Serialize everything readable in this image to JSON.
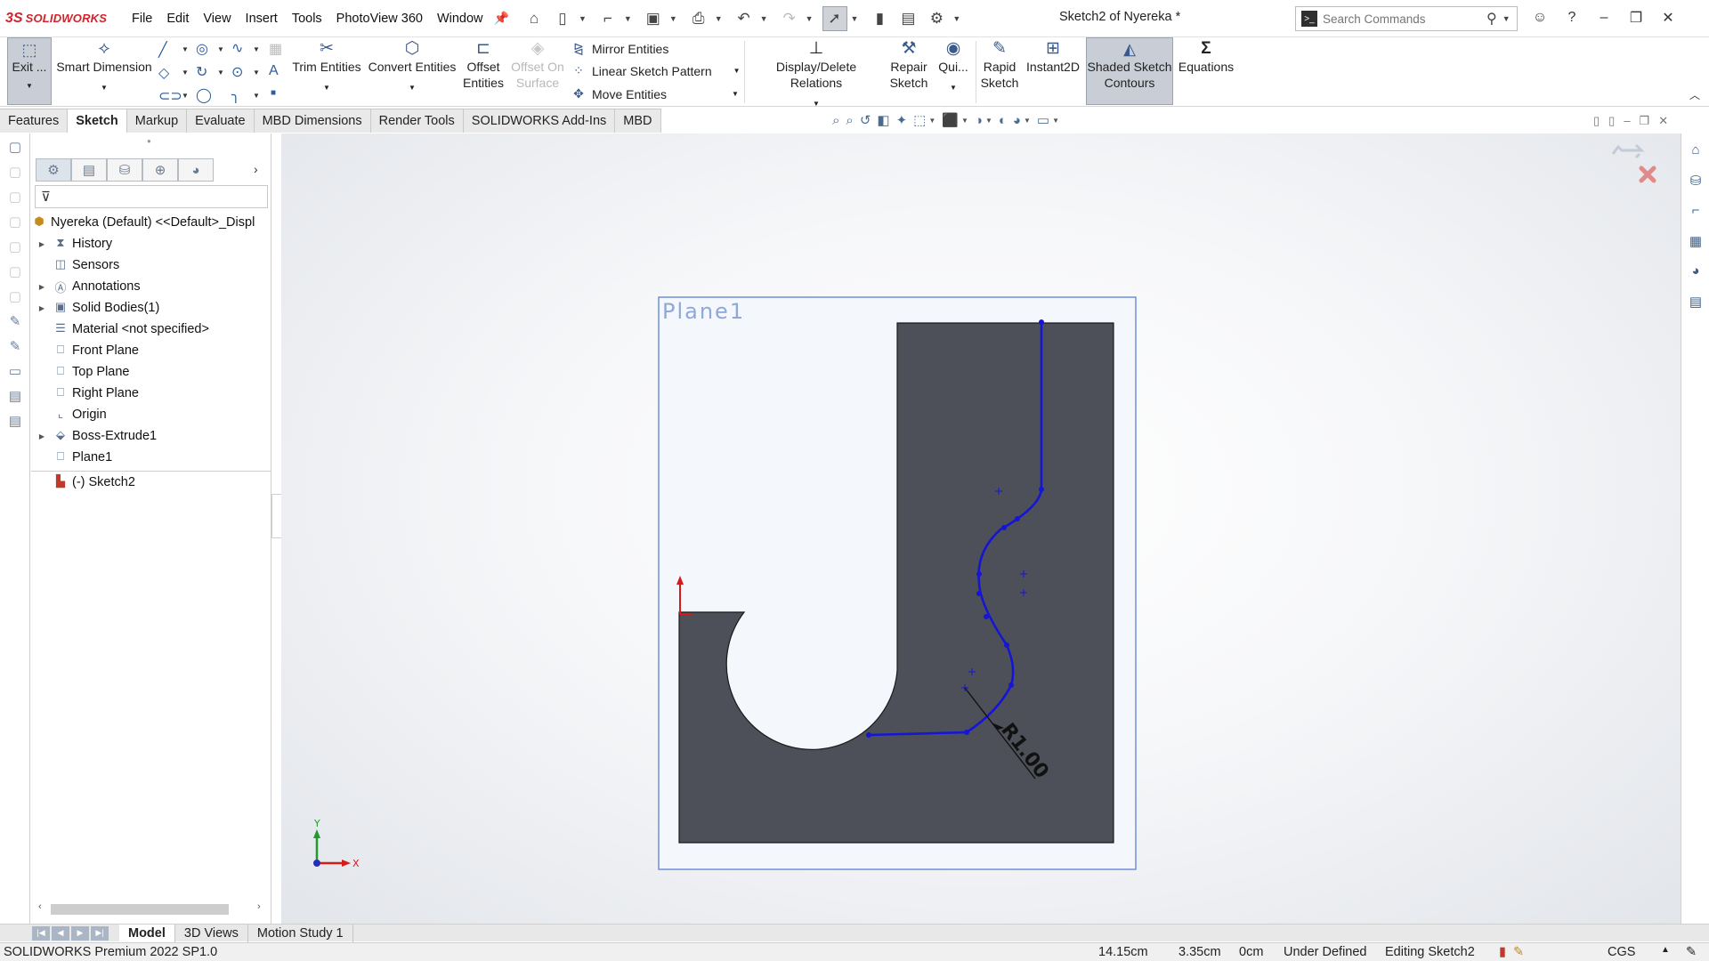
{
  "app": {
    "brand": "SOLIDWORKS",
    "logo_mark": "3S",
    "document_title": "Sketch2 of Nyereka *"
  },
  "menu": [
    "File",
    "Edit",
    "View",
    "Insert",
    "Tools",
    "PhotoView 360",
    "Window"
  ],
  "search": {
    "placeholder": "Search Commands"
  },
  "ribbon": {
    "exit": "Exit ...",
    "smart_dimension": "Smart Dimension",
    "trim": "Trim Entities",
    "convert": "Convert Entities",
    "offset_line1": "Offset",
    "offset_line2": "Entities",
    "offset_surface_line1": "Offset On",
    "offset_surface_line2": "Surface",
    "mirror": "Mirror Entities",
    "linear_pattern": "Linear Sketch Pattern",
    "move": "Move Entities",
    "display_relations": "Display/Delete Relations",
    "repair_line1": "Repair",
    "repair_line2": "Sketch",
    "quick_snaps": "Qui...",
    "rapid_line1": "Rapid",
    "rapid_line2": "Sketch",
    "instant2d": "Instant2D",
    "shaded_line1": "Shaded Sketch",
    "shaded_line2": "Contours",
    "equations": "Equations"
  },
  "tabs": [
    "Features",
    "Sketch",
    "Markup",
    "Evaluate",
    "MBD Dimensions",
    "Render Tools",
    "SOLIDWORKS Add-Ins",
    "MBD"
  ],
  "active_tab": "Sketch",
  "tree": {
    "root": "Nyereka (Default) <<Default>_Displ",
    "items": [
      {
        "label": "History",
        "expandable": true,
        "icon": "history-icon"
      },
      {
        "label": "Sensors",
        "expandable": false,
        "icon": "sensor-icon"
      },
      {
        "label": "Annotations",
        "expandable": true,
        "icon": "annotation-icon"
      },
      {
        "label": "Solid Bodies(1)",
        "expandable": true,
        "icon": "solid-body-icon"
      },
      {
        "label": "Material <not specified>",
        "expandable": false,
        "icon": "material-icon"
      },
      {
        "label": "Front Plane",
        "expandable": false,
        "icon": "plane-icon"
      },
      {
        "label": "Top Plane",
        "expandable": false,
        "icon": "plane-icon"
      },
      {
        "label": "Right Plane",
        "expandable": false,
        "icon": "plane-icon"
      },
      {
        "label": "Origin",
        "expandable": false,
        "icon": "origin-icon"
      },
      {
        "label": "Boss-Extrude1",
        "expandable": true,
        "icon": "extrude-icon"
      },
      {
        "label": "Plane1",
        "expandable": false,
        "icon": "plane-icon"
      },
      {
        "label": "(-) Sketch2",
        "expandable": false,
        "icon": "sketch-icon"
      }
    ]
  },
  "viewport": {
    "plane_label": "Plane1",
    "dimension_label": "R1.00",
    "triad_x": "X",
    "triad_y": "Y"
  },
  "bottom_tabs": [
    "Model",
    "3D Views",
    "Motion Study 1"
  ],
  "active_bottom_tab": "Model",
  "status": {
    "product": "SOLIDWORKS Premium 2022 SP1.0",
    "x": "14.15cm",
    "y": "3.35cm",
    "z": "0cm",
    "state": "Under Defined",
    "editing": "Editing Sketch2",
    "units": "CGS"
  },
  "colors": {
    "part_fill": "#4d5058",
    "sketch_blue": "#1515d6",
    "plane_border": "#6f91d8",
    "brand_red": "#d2232a"
  }
}
